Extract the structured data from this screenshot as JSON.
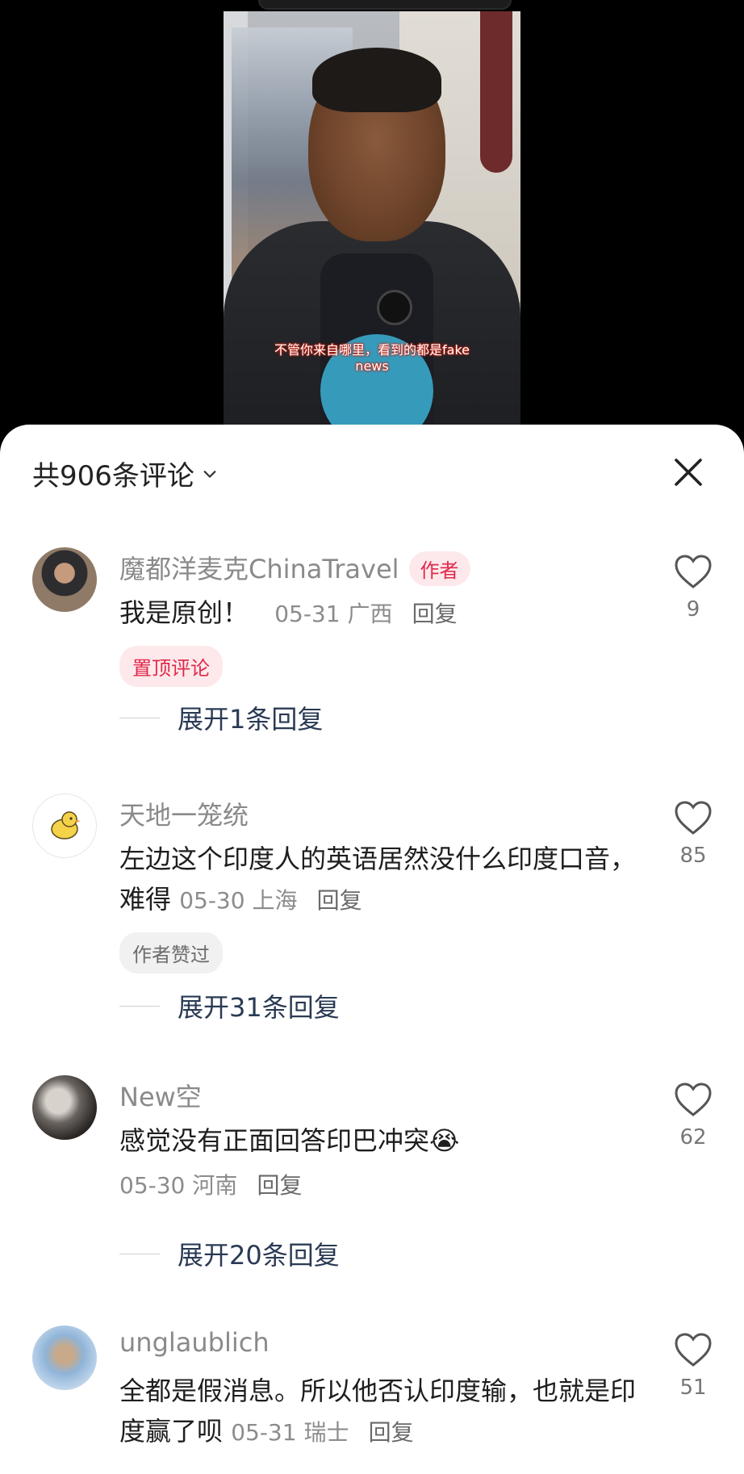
{
  "video": {
    "subtitle_line1": "不管你来自哪里，看到的都是fake",
    "subtitle_line2": "news"
  },
  "sheet": {
    "title": "共906条评论",
    "chevron_icon": "chevron-down-icon",
    "close_icon": "close-icon"
  },
  "comments": [
    {
      "username": "魔都洋麦克ChinaTravel",
      "author_tag": "作者",
      "text": "我是原创！",
      "meta": "05-31 广西",
      "reply": "回复",
      "badge": "置顶评论",
      "likes": "9",
      "expand": "展开1条回复"
    },
    {
      "username": "天地一笼统",
      "text": "左边这个印度人的英语居然没什么印度口音，难得",
      "meta": "05-30 上海",
      "reply": "回复",
      "badge": "作者赞过",
      "likes": "85",
      "expand": "展开31条回复"
    },
    {
      "username": "New空",
      "text": "感觉没有正面回答印巴冲突😭",
      "meta": "05-30 河南",
      "reply": "回复",
      "likes": "62",
      "expand": "展开20条回复"
    },
    {
      "username": "unglaublich",
      "text": "全都是假消息。所以他否认印度输，也就是印度赢了呗",
      "meta": "05-31 瑞士",
      "reply": "回复",
      "likes": "51"
    }
  ],
  "colors": {
    "accent": "#e0294b",
    "accent_bg": "#fde9ec",
    "expand_text": "#2a3a54"
  }
}
